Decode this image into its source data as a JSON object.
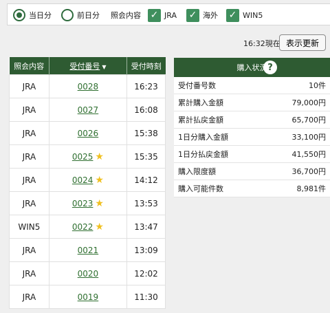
{
  "filters": {
    "today": "当日分",
    "previous_day": "前日分",
    "query_label": "照会内容",
    "jra": "JRA",
    "overseas": "海外",
    "win5": "WIN5",
    "check_glyph": "✓"
  },
  "refresh": {
    "time_text": "16:32現在",
    "button_label": "表示更新"
  },
  "receipts": {
    "headers": {
      "content": "照会内容",
      "number": "受付番号",
      "time": "受付時刻"
    },
    "sort_glyph": "▼",
    "star_glyph": "★",
    "rows": [
      {
        "content": "JRA",
        "number": "0028",
        "time": "16:23",
        "starred": false
      },
      {
        "content": "JRA",
        "number": "0027",
        "time": "16:08",
        "starred": false
      },
      {
        "content": "JRA",
        "number": "0026",
        "time": "15:38",
        "starred": false
      },
      {
        "content": "JRA",
        "number": "0025",
        "time": "15:35",
        "starred": true
      },
      {
        "content": "JRA",
        "number": "0024",
        "time": "14:12",
        "starred": true
      },
      {
        "content": "JRA",
        "number": "0023",
        "time": "13:53",
        "starred": true
      },
      {
        "content": "WIN5",
        "number": "0022",
        "time": "13:47",
        "starred": true
      },
      {
        "content": "JRA",
        "number": "0021",
        "time": "13:09",
        "starred": false
      },
      {
        "content": "JRA",
        "number": "0020",
        "time": "12:02",
        "starred": false
      },
      {
        "content": "JRA",
        "number": "0019",
        "time": "11:30",
        "starred": false
      }
    ]
  },
  "status": {
    "title": "購入状況",
    "help_glyph": "?",
    "rows": [
      {
        "label": "受付番号数",
        "value": "10件"
      },
      {
        "label": "累計購入金額",
        "value": "79,000円"
      },
      {
        "label": "累計払戻金額",
        "value": "65,700円"
      },
      {
        "label": "1日分購入金額",
        "value": "33,100円"
      },
      {
        "label": "1日分払戻金額",
        "value": "41,550円"
      },
      {
        "label": "購入限度額",
        "value": "36,700円"
      },
      {
        "label": "購入可能件数",
        "value": "8,981件"
      }
    ]
  },
  "colors": {
    "header_green": "#2e5b32",
    "check_green": "#3f8f5d",
    "link_green": "#2f6f30",
    "star": "#f0c020"
  }
}
